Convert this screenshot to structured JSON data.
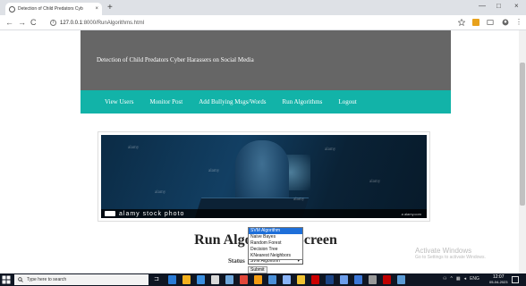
{
  "browser": {
    "tab_title": "Detection of Child Predators Cyb",
    "tab_close": "×",
    "new_tab": "+",
    "url_host": "127.0.0.1",
    "url_path": ":8000/RunAlgorithms.html",
    "back": "←",
    "forward": "→",
    "reload": "C",
    "minimize": "—",
    "restore": "□",
    "close": "×",
    "info_icon": "i"
  },
  "site": {
    "title": "Detection of Child Predators Cyber Harassers on Social Media",
    "menu": [
      "View Users",
      "Monitor Post",
      "Add Bullying Msgs/Words",
      "Run Algorithms",
      "Logout"
    ]
  },
  "image": {
    "stock_text": "alamy stock photo",
    "watermarks": [
      "alamy",
      "alamy",
      "alamy",
      "alamy",
      "alamy",
      "alamy"
    ],
    "image_id": "a alamy.com"
  },
  "main": {
    "heading": "Run Algorithms Screen",
    "status_label": "Status",
    "select_value": "SVM Algorithm",
    "options": [
      "SVM Algorithm",
      "Naive Bayes",
      "Random Forest",
      "Decision Tree",
      "KNearest Neighbors",
      "SVM Algorithm"
    ],
    "submit_label": "Submit"
  },
  "activate": {
    "line1": "Activate Windows",
    "line2": "Go to Settings to activate Windows."
  },
  "taskbar": {
    "search_placeholder": "Type here to search",
    "clock_time": "12:07",
    "clock_date": "05-04-2023",
    "tray_text": "ENG"
  },
  "colors": {
    "menu_bg": "#12b3a8",
    "header_bg": "#666666",
    "taskbar_bg": "#0f1623",
    "dropdown_highlight": "#1e6fd9"
  }
}
